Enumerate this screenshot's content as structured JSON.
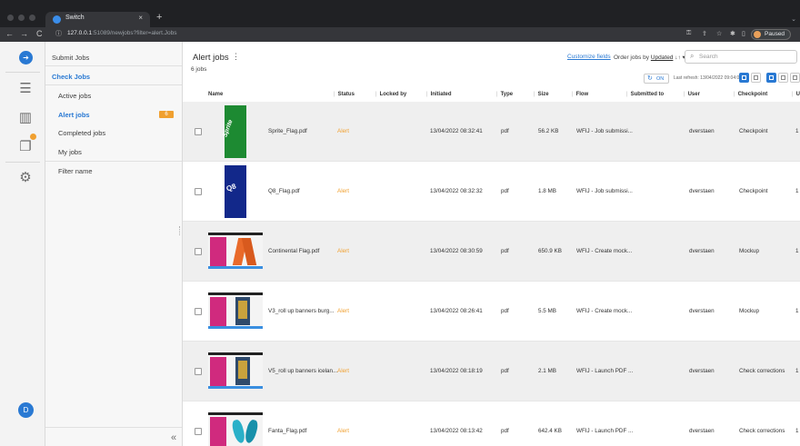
{
  "browser": {
    "tab_title": "Switch",
    "tab_close": "×",
    "new_tab": "+",
    "window_arrow": "⌄",
    "url_host": "127.0.0.1",
    "url_path": ":51089/newjobs?filter=alert.Jobs",
    "profile_status": "Paused",
    "nav": {
      "back": "←",
      "forward": "→",
      "reload": "C"
    }
  },
  "rail": {
    "user_initial": "D",
    "logo_glyph": "➔",
    "icons": [
      "list-icon",
      "board-icon",
      "jobs-icon",
      "gear-icon"
    ]
  },
  "sidebar": {
    "submit_jobs": "Submit Jobs",
    "check_jobs": "Check Jobs",
    "active_jobs": "Active jobs",
    "alert_jobs": "Alert jobs",
    "alert_count": "6",
    "completed_jobs": "Completed jobs",
    "my_jobs": "My jobs",
    "filter_name": "Filter name",
    "collapse": "«"
  },
  "main": {
    "title": "Alert jobs",
    "title_menu": "⋮",
    "job_count": "6 jobs",
    "customize_fields": "Customize fields",
    "order_prefix": "Order jobs by",
    "order_field": "Updated",
    "order_suffix": "↓↑ ▾",
    "search_placeholder": "Search",
    "refresh_label": "ON",
    "last_refresh": "Last refresh: 13/04/2022 09:04:06"
  },
  "table": {
    "columns": [
      "Name",
      "Status",
      "Locked by",
      "Initiated",
      "Type",
      "Size",
      "Flow",
      "Submitted to",
      "User",
      "Checkpoint",
      "U"
    ],
    "rows": [
      {
        "name": "Sprite_Flag.pdf",
        "status": "Alert",
        "initiated": "13/04/2022 08:32:41",
        "type": "pdf",
        "size": "56.2 KB",
        "flow": "WFIJ - Job submissi...",
        "user": "dverstaen",
        "checkpoint": "Checkpoint",
        "extra": "1",
        "thumb": "sprite",
        "thumb_text": "Sprite"
      },
      {
        "name": "Q8_Flag.pdf",
        "status": "Alert",
        "initiated": "13/04/2022 08:32:32",
        "type": "pdf",
        "size": "1.8 MB",
        "flow": "WFIJ - Job submissi...",
        "user": "dverstaen",
        "checkpoint": "Checkpoint",
        "extra": "1",
        "thumb": "q8",
        "thumb_text": "Q8"
      },
      {
        "name": "Continental Flag.pdf",
        "status": "Alert",
        "initiated": "13/04/2022 08:30:59",
        "type": "pdf",
        "size": "650.9 KB",
        "flow": "WFIJ - Create mock...",
        "user": "dverstaen",
        "checkpoint": "Mockup",
        "extra": "1",
        "thumb": "flags",
        "thumb_text": ""
      },
      {
        "name": "V3_roll up banners burg...",
        "status": "Alert",
        "initiated": "13/04/2022 08:26:41",
        "type": "pdf",
        "size": "5.5 MB",
        "flow": "WFIJ - Create mock...",
        "user": "dverstaen",
        "checkpoint": "Mockup",
        "extra": "1",
        "thumb": "banner",
        "thumb_text": ""
      },
      {
        "name": "V5_roll up banners icelan...",
        "status": "Alert",
        "initiated": "13/04/2022 08:18:19",
        "type": "pdf",
        "size": "2.1 MB",
        "flow": "WFIJ - Launch PDF ...",
        "user": "dverstaen",
        "checkpoint": "Check corrections",
        "extra": "1",
        "thumb": "banner",
        "thumb_text": ""
      },
      {
        "name": "Fanta_Flag.pdf",
        "status": "Alert",
        "initiated": "13/04/2022 08:13:42",
        "type": "pdf",
        "size": "642.4 KB",
        "flow": "WFIJ - Launch PDF ...",
        "user": "dverstaen",
        "checkpoint": "Check corrections",
        "extra": "1",
        "thumb": "fanta",
        "thumb_text": ""
      }
    ]
  },
  "colors": {
    "accent": "#2979d3",
    "alert": "#f0a030",
    "chrome": "#202124"
  }
}
